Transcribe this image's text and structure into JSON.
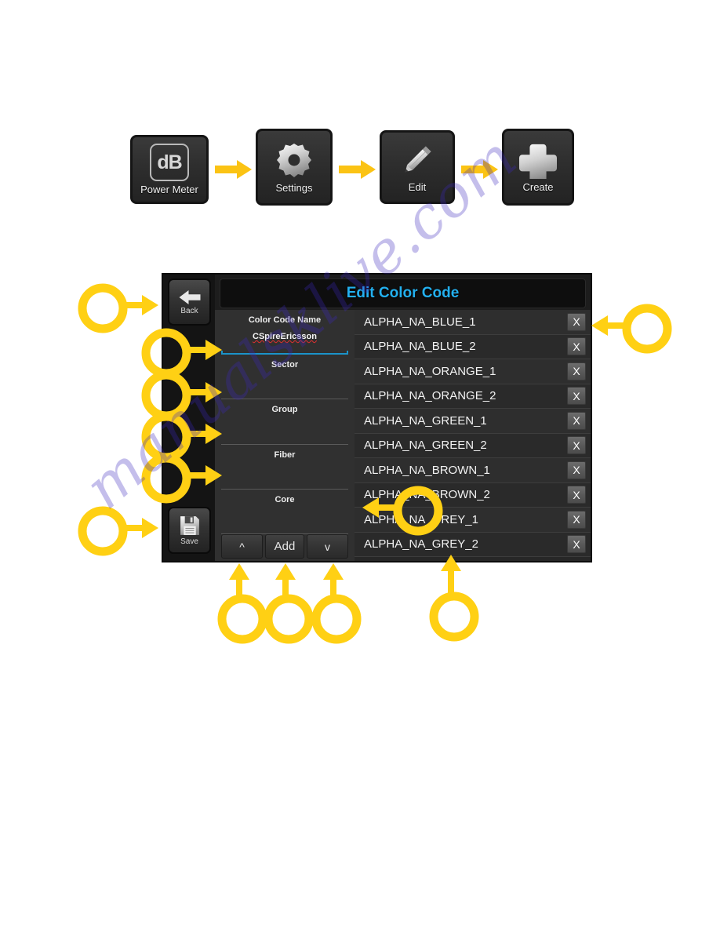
{
  "flow": {
    "steps": [
      {
        "label": "Power Meter",
        "icon": "db-meter-icon",
        "glyph": "dB"
      },
      {
        "label": "Settings",
        "icon": "gear-icon",
        "glyph": "gear"
      },
      {
        "label": "Edit",
        "icon": "pencil-icon",
        "glyph": "pencil"
      },
      {
        "label": "Create",
        "icon": "plus-icon",
        "glyph": "plus"
      }
    ],
    "arrow_icon": "arrow-right-icon"
  },
  "device": {
    "title": "Edit Color Code",
    "title_color": "#23b0ef",
    "accent_color": "#1b93c9",
    "rail": {
      "back": {
        "label": "Back",
        "icon": "arrow-left-icon"
      },
      "save": {
        "label": "Save",
        "icon": "floppy-disk-icon"
      }
    },
    "form": {
      "fields": [
        {
          "label": "Color Code Name",
          "value": "CSpireEricsson",
          "active": true,
          "spellcheck": true
        },
        {
          "label": "Sector",
          "value": "",
          "active": false,
          "spellcheck": false
        },
        {
          "label": "Group",
          "value": "",
          "active": false,
          "spellcheck": false
        },
        {
          "label": "Fiber",
          "value": "",
          "active": false,
          "spellcheck": false
        },
        {
          "label": "Core",
          "value": "",
          "active": false,
          "spellcheck": false
        }
      ]
    },
    "buttons": {
      "up": "^",
      "add": "Add",
      "down": "v"
    },
    "list": {
      "delete_label": "X",
      "items": [
        "ALPHA_NA_BLUE_1",
        "ALPHA_NA_BLUE_2",
        "ALPHA_NA_ORANGE_1",
        "ALPHA_NA_ORANGE_2",
        "ALPHA_NA_GREEN_1",
        "ALPHA_NA_GREEN_2",
        "ALPHA_NA_BROWN_1",
        "ALPHA_NA_BROWN_2",
        "ALPHA_NA_GREY_1",
        "ALPHA_NA_GREY_2"
      ]
    }
  },
  "callouts": {
    "color": "#FFD014",
    "markers": [
      {
        "name": "callout-back",
        "target": "Back button"
      },
      {
        "name": "callout-color-code-name",
        "target": "Color Code Name field"
      },
      {
        "name": "callout-sector",
        "target": "Sector field"
      },
      {
        "name": "callout-group",
        "target": "Group field"
      },
      {
        "name": "callout-fiber",
        "target": "Fiber field"
      },
      {
        "name": "callout-save",
        "target": "Save button"
      },
      {
        "name": "callout-delete",
        "target": "X delete button"
      },
      {
        "name": "callout-core",
        "target": "Core field"
      },
      {
        "name": "callout-up",
        "target": "Up button"
      },
      {
        "name": "callout-add",
        "target": "Add button"
      },
      {
        "name": "callout-down",
        "target": "Down button"
      },
      {
        "name": "callout-list",
        "target": "Color code list"
      }
    ]
  },
  "watermark": {
    "text": "manualsklive.com"
  }
}
